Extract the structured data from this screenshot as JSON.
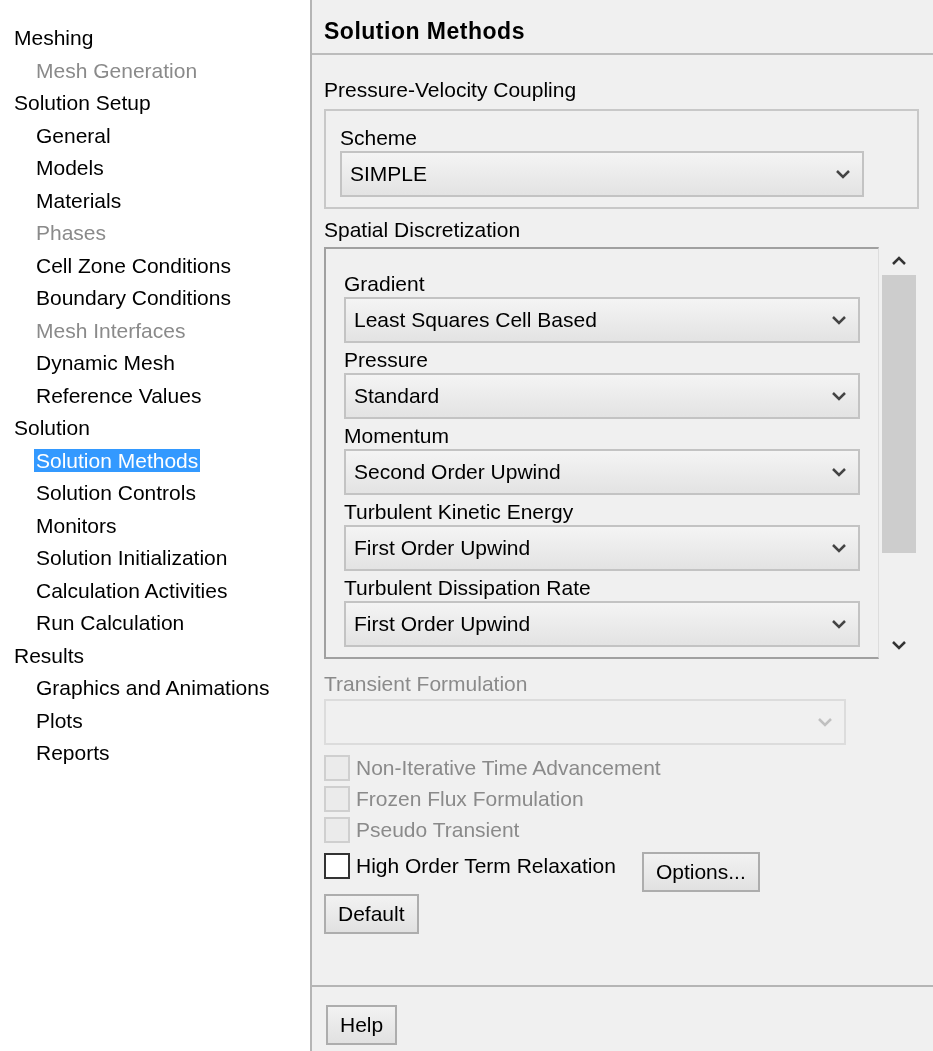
{
  "sidebar": {
    "groups": [
      {
        "label": "Meshing",
        "items": [
          {
            "label": "Mesh Generation",
            "disabled": true,
            "selected": false
          }
        ]
      },
      {
        "label": "Solution Setup",
        "items": [
          {
            "label": "General",
            "disabled": false,
            "selected": false
          },
          {
            "label": "Models",
            "disabled": false,
            "selected": false
          },
          {
            "label": "Materials",
            "disabled": false,
            "selected": false
          },
          {
            "label": "Phases",
            "disabled": true,
            "selected": false
          },
          {
            "label": "Cell Zone Conditions",
            "disabled": false,
            "selected": false
          },
          {
            "label": "Boundary Conditions",
            "disabled": false,
            "selected": false
          },
          {
            "label": "Mesh Interfaces",
            "disabled": true,
            "selected": false
          },
          {
            "label": "Dynamic Mesh",
            "disabled": false,
            "selected": false
          },
          {
            "label": "Reference Values",
            "disabled": false,
            "selected": false
          }
        ]
      },
      {
        "label": "Solution",
        "items": [
          {
            "label": "Solution Methods",
            "disabled": false,
            "selected": true
          },
          {
            "label": "Solution Controls",
            "disabled": false,
            "selected": false
          },
          {
            "label": "Monitors",
            "disabled": false,
            "selected": false
          },
          {
            "label": "Solution Initialization",
            "disabled": false,
            "selected": false
          },
          {
            "label": "Calculation Activities",
            "disabled": false,
            "selected": false
          },
          {
            "label": "Run Calculation",
            "disabled": false,
            "selected": false
          }
        ]
      },
      {
        "label": "Results",
        "items": [
          {
            "label": "Graphics and Animations",
            "disabled": false,
            "selected": false
          },
          {
            "label": "Plots",
            "disabled": false,
            "selected": false
          },
          {
            "label": "Reports",
            "disabled": false,
            "selected": false
          }
        ]
      }
    ]
  },
  "panel": {
    "title": "Solution Methods",
    "pv_coupling": {
      "label": "Pressure-Velocity Coupling",
      "scheme": {
        "label": "Scheme",
        "value": "SIMPLE"
      }
    },
    "spatial": {
      "label": "Spatial Discretization",
      "fields": [
        {
          "label": "Gradient",
          "value": "Least Squares Cell Based"
        },
        {
          "label": "Pressure",
          "value": "Standard"
        },
        {
          "label": "Momentum",
          "value": "Second Order Upwind"
        },
        {
          "label": "Turbulent Kinetic Energy",
          "value": "First Order Upwind"
        },
        {
          "label": "Turbulent Dissipation Rate",
          "value": "First Order Upwind"
        }
      ]
    },
    "transient": {
      "label": "Transient Formulation",
      "disabled": true
    },
    "options": [
      {
        "label": "Non-Iterative Time Advancement",
        "checked": false,
        "disabled": true
      },
      {
        "label": "Frozen Flux Formulation",
        "checked": false,
        "disabled": true
      },
      {
        "label": "Pseudo Transient",
        "checked": false,
        "disabled": true
      },
      {
        "label": "High Order Term Relaxation",
        "checked": false,
        "disabled": false
      }
    ],
    "options_button": "Options...",
    "default_button": "Default",
    "help_button": "Help"
  }
}
